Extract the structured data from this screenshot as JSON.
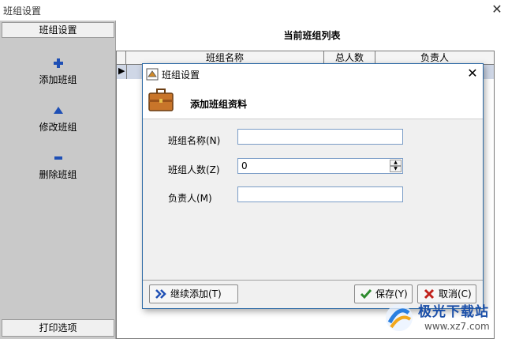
{
  "window": {
    "title": "班组设置",
    "close_glyph": "✕"
  },
  "left_panel": {
    "header": "班组设置",
    "actions": [
      {
        "label": "添加班组",
        "icon": "plus-icon"
      },
      {
        "label": "修改班组",
        "icon": "triangle-up-icon"
      },
      {
        "label": "删除班组",
        "icon": "minus-icon"
      }
    ],
    "footer": "打印选项"
  },
  "list": {
    "title": "当前班组列表",
    "columns": [
      "班组名称",
      "总人数",
      "负责人"
    ],
    "row_indicator": "▶"
  },
  "dialog": {
    "title": "班组设置",
    "close_glyph": "✕",
    "heading": "添加班组资料",
    "fields": {
      "name_label": "班组名称(N)",
      "name_value": "",
      "count_label": "班组人数(Z)",
      "count_value": "0",
      "leader_label": "负责人(M)",
      "leader_value": ""
    },
    "buttons": {
      "continue_add": "继续添加(T)",
      "save": "保存(Y)",
      "cancel": "取消(C)"
    }
  },
  "watermark": {
    "brand": "极光下载站",
    "url": "www.xz7.com"
  },
  "colors": {
    "panel_gray": "#c9c9c9",
    "selection_blue": "#cfd7e6",
    "accent_blue": "#1e4fb5",
    "save_green": "#2e8b2e",
    "cancel_red": "#c0201a"
  }
}
